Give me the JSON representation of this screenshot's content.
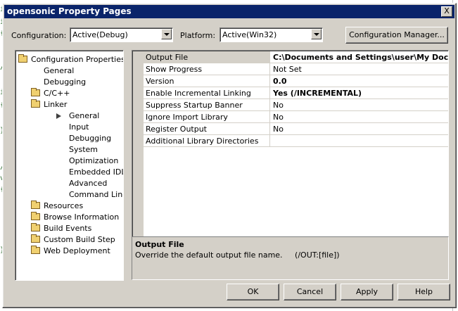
{
  "dialog": {
    "title": "opensonic Property Pages",
    "close_glyph": "X"
  },
  "toolbar": {
    "configuration_label": "Configuration:",
    "configuration_value": "Active(Debug)",
    "platform_label": "Platform:",
    "platform_value": "Active(Win32)",
    "config_manager_label": "Configuration Manager..."
  },
  "tree": {
    "root": "Configuration Properties",
    "general": "General",
    "debugging": "Debugging",
    "cpp": "C/C++",
    "linker": "Linker",
    "linker_items": [
      "General",
      "Input",
      "Debugging",
      "System",
      "Optimization",
      "Embedded IDL",
      "Advanced",
      "Command Line"
    ],
    "folders": [
      "Resources",
      "Browse Information",
      "Build Events",
      "Custom Build Step",
      "Web Deployment"
    ]
  },
  "grid": {
    "rows": [
      {
        "name": "Output File",
        "value": "C:\\Documents and Settings\\user\\My Docum"
      },
      {
        "name": "Show Progress",
        "value": "Not Set"
      },
      {
        "name": "Version",
        "value": "0.0"
      },
      {
        "name": "Enable Incremental Linking",
        "value": "Yes (/INCREMENTAL)"
      },
      {
        "name": "Suppress Startup Banner",
        "value": "No"
      },
      {
        "name": "Ignore Import Library",
        "value": "No"
      },
      {
        "name": "Register Output",
        "value": "No"
      },
      {
        "name": "Additional Library Directories",
        "value": ""
      }
    ]
  },
  "description": {
    "title": "Output File",
    "text": "Override the default output file name.     (/OUT:[file])"
  },
  "buttons": {
    "ok": "OK",
    "cancel": "Cancel",
    "apply": "Apply",
    "help": "Help"
  },
  "colors": {
    "titlebar": "#0a246a",
    "face": "#d4d0c8"
  }
}
